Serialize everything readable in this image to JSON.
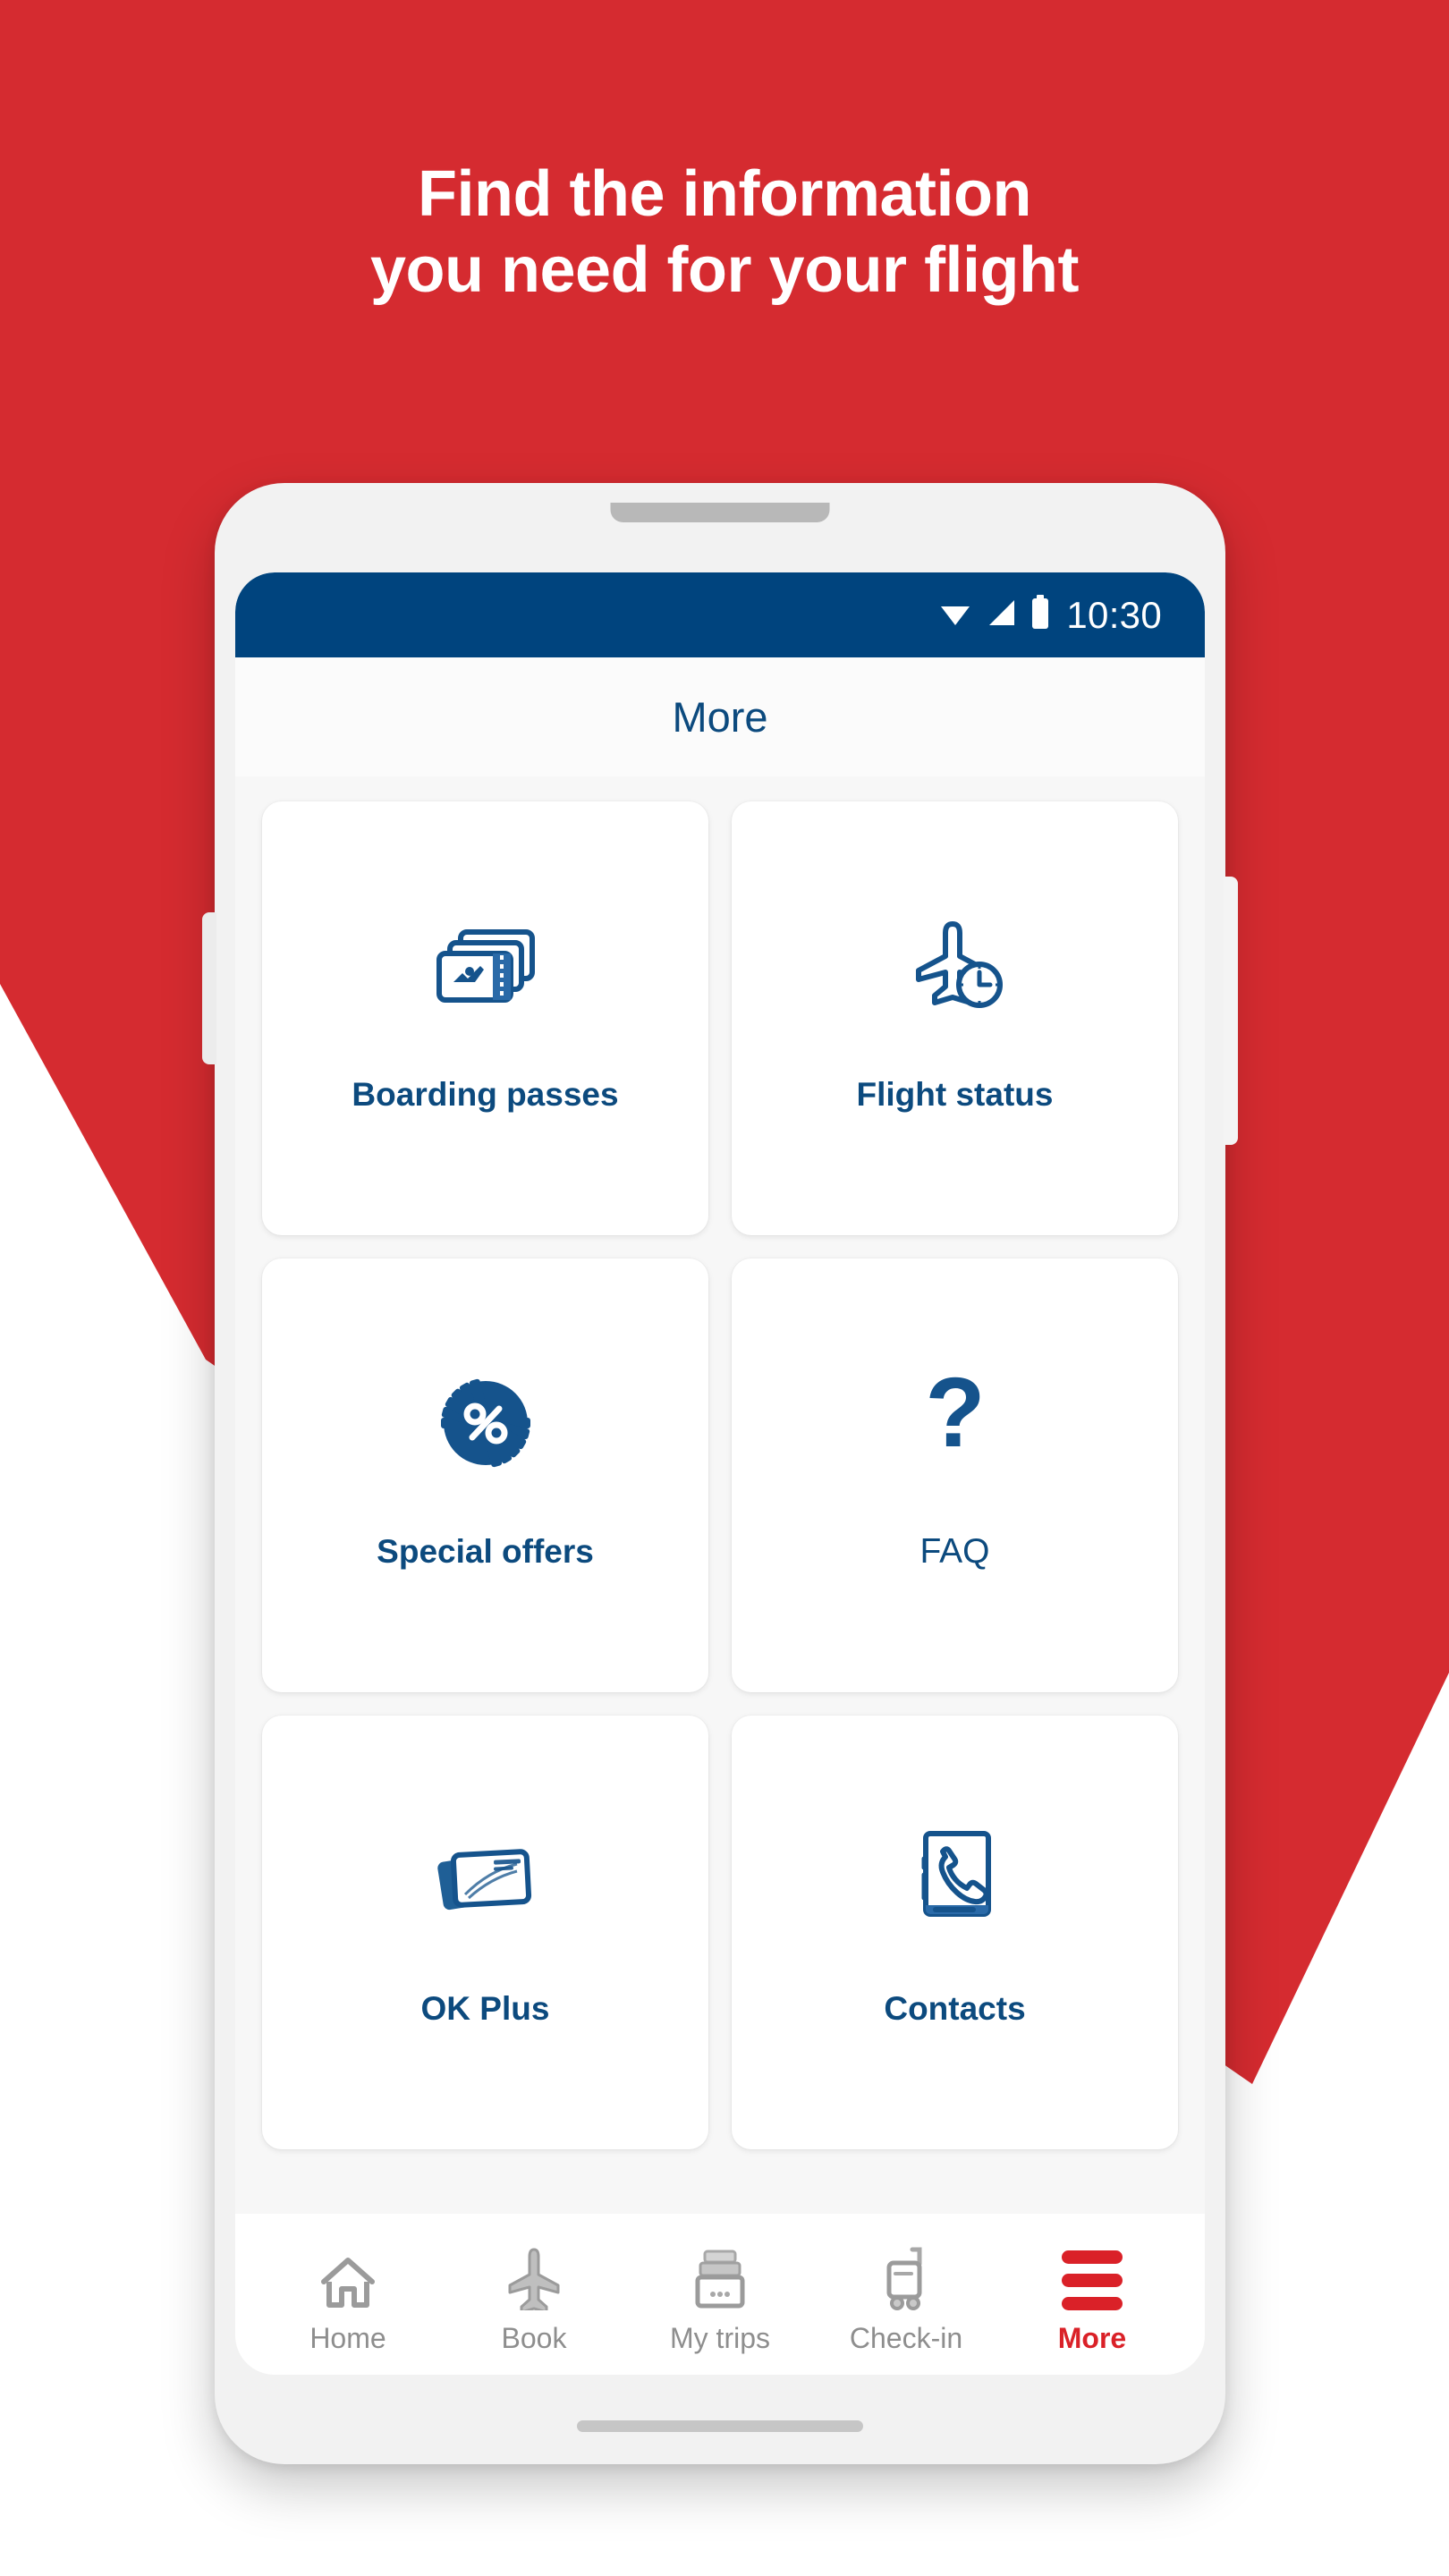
{
  "background": {
    "red": "#D52B30"
  },
  "promo": {
    "headline": "Find the information\nyou need for your flight"
  },
  "phone": {
    "statusbar": {
      "time": "10:30",
      "icons": [
        "wifi-icon",
        "cellular-signal-icon",
        "battery-icon"
      ],
      "background_color": "#00447E"
    },
    "app_header": {
      "title": "More"
    },
    "accent_color": "#0C4A7E",
    "active_nav_color": "#DA2128"
  },
  "main": {
    "cards": [
      {
        "label": "Boarding passes",
        "icon": "boarding-passes-icon",
        "bold": true
      },
      {
        "label": "Flight status",
        "icon": "flight-status-icon",
        "bold": true
      },
      {
        "label": "Special offers",
        "icon": "special-offers-icon",
        "bold": true
      },
      {
        "label": "FAQ",
        "icon": "question-mark-icon",
        "bold": false
      },
      {
        "label": "OK Plus",
        "icon": "membership-cards-icon",
        "bold": true
      },
      {
        "label": "Contacts",
        "icon": "contacts-book-icon",
        "bold": true
      }
    ]
  },
  "bottom_nav": {
    "items": [
      {
        "label": "Home",
        "icon": "home-icon",
        "active": false
      },
      {
        "label": "Book",
        "icon": "airplane-icon",
        "active": false
      },
      {
        "label": "My trips",
        "icon": "suitcase-icon",
        "active": false
      },
      {
        "label": "Check-in",
        "icon": "luggage-icon",
        "active": false
      },
      {
        "label": "More",
        "icon": "hamburger-icon",
        "active": true
      }
    ]
  }
}
